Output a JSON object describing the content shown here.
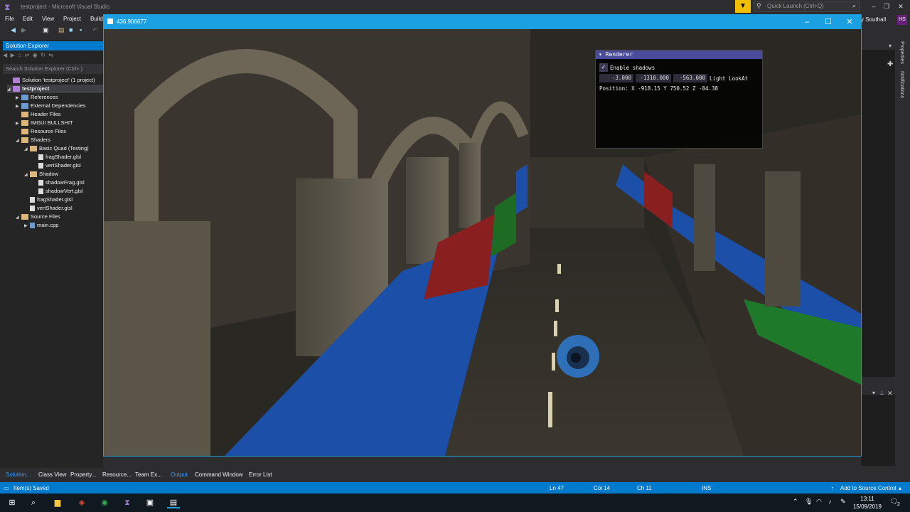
{
  "vs": {
    "title": "testproject - Microsoft Visual Studio",
    "quick_launch_placeholder": "Quick Launch (Ctrl+Q)",
    "user_name": "y Southall",
    "user_initials": "HS",
    "menu": [
      "File",
      "Edit",
      "View",
      "Project",
      "Build"
    ]
  },
  "solution_explorer": {
    "header": "Solution Explorer",
    "search_placeholder": "Search Solution Explorer (Ctrl+;)",
    "items": [
      {
        "label": "Solution 'testproject' (1 project)",
        "indent": 0,
        "arrow": "",
        "icon": "proj"
      },
      {
        "label": "testproject",
        "indent": 0,
        "arrow": "◢",
        "icon": "proj",
        "bold": true
      },
      {
        "label": "References",
        "indent": 1,
        "arrow": "▶",
        "icon": "ref"
      },
      {
        "label": "External Dependencies",
        "indent": 1,
        "arrow": "▶",
        "icon": "ref"
      },
      {
        "label": "Header Files",
        "indent": 1,
        "arrow": "",
        "icon": "folder"
      },
      {
        "label": "IMGUI BULLSHIT",
        "indent": 1,
        "arrow": "▶",
        "icon": "folder"
      },
      {
        "label": "Resource Files",
        "indent": 1,
        "arrow": "",
        "icon": "folder"
      },
      {
        "label": "Shaders",
        "indent": 1,
        "arrow": "◢",
        "icon": "folder"
      },
      {
        "label": "Basic Quad (Testing)",
        "indent": 2,
        "arrow": "◢",
        "icon": "folder"
      },
      {
        "label": "fragShader.glsl",
        "indent": 3,
        "arrow": "",
        "icon": "file"
      },
      {
        "label": "vertShader.glsl",
        "indent": 3,
        "arrow": "",
        "icon": "file"
      },
      {
        "label": "Shadow",
        "indent": 2,
        "arrow": "◢",
        "icon": "folder"
      },
      {
        "label": "shadowFrag.glsl",
        "indent": 3,
        "arrow": "",
        "icon": "file"
      },
      {
        "label": "shadowVert.glsl",
        "indent": 3,
        "arrow": "",
        "icon": "file"
      },
      {
        "label": "fragShader.glsl",
        "indent": 2,
        "arrow": "",
        "icon": "file"
      },
      {
        "label": "vertShader.glsl",
        "indent": 2,
        "arrow": "",
        "icon": "file"
      },
      {
        "label": "Source Files",
        "indent": 1,
        "arrow": "◢",
        "icon": "folder"
      },
      {
        "label": "main.cpp",
        "indent": 2,
        "arrow": "▶",
        "icon": "cpp"
      }
    ]
  },
  "right_tabs": [
    "Properties",
    "Notifications"
  ],
  "game": {
    "title": "436.906677"
  },
  "imgui": {
    "title": "Renderer",
    "checkbox_label": "Enable shadows",
    "field_x": "-3.000",
    "field_y": "-1310.000",
    "field_z": "-563.000",
    "field_label": "Light LookAt",
    "position_text": "Position: X -918.15 Y 750.52 Z -84.38"
  },
  "bottom_tabs": [
    "Solution...",
    "Class View",
    "Property...",
    "Resource...",
    "Team Ex...",
    "Output",
    "Command Window",
    "Error List"
  ],
  "status": {
    "message": "Item(s) Saved",
    "ln": "Ln 47",
    "col": "Col 14",
    "ch": "Ch 11",
    "ins": "INS",
    "source_control": "Add to Source Control"
  },
  "taskbar": {
    "time": "13:11",
    "date": "15/09/2019",
    "notif_count": "2"
  },
  "colors": {
    "accent": "#007acc",
    "game_border": "#1ba1e2",
    "imgui_title": "#4a4b9a"
  }
}
